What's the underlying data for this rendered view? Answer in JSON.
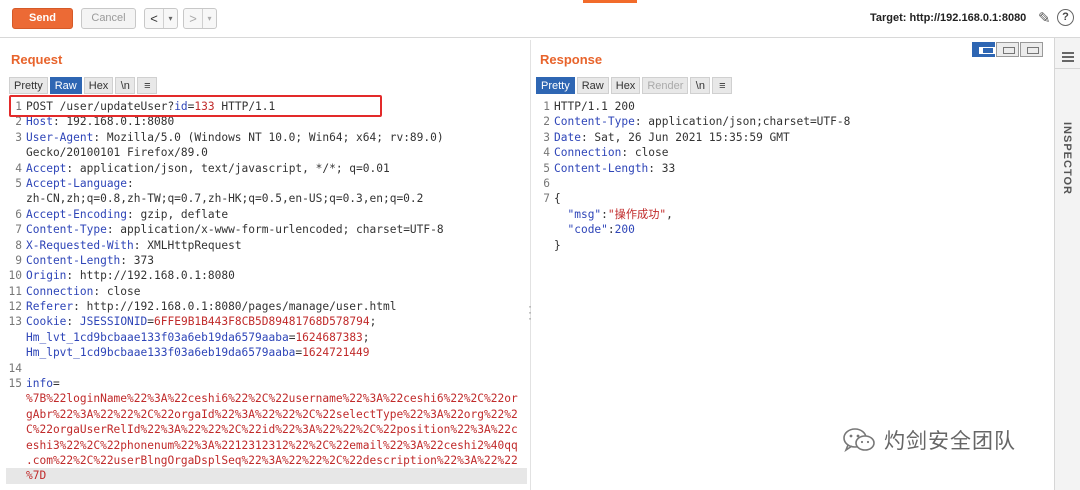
{
  "toolbar": {
    "send": "Send",
    "cancel": "Cancel",
    "back": "<",
    "forward": ">",
    "dropdown": "▾",
    "target": "Target: http://192.168.0.1:8080",
    "help": "?"
  },
  "request": {
    "title": "Request",
    "tabs": [
      "Pretty",
      "Raw",
      "Hex",
      "\\n",
      "≡"
    ],
    "active_tab": "Raw"
  },
  "response": {
    "title": "Response",
    "tabs": [
      "Pretty",
      "Raw",
      "Hex",
      "Render",
      "\\n",
      "≡"
    ],
    "active_tab": "Pretty"
  },
  "request_lines": [
    {
      "n": "1",
      "parts": [
        [
          "t",
          "POST /user/updateUser?"
        ],
        [
          "b",
          "id"
        ],
        [
          "t",
          "="
        ],
        [
          "r",
          "133"
        ],
        [
          "t",
          " HTTP/1.1"
        ]
      ]
    },
    {
      "n": "2",
      "parts": [
        [
          "h",
          "Host"
        ],
        [
          "t",
          ": 192.168.0.1:8080"
        ]
      ]
    },
    {
      "n": "3",
      "parts": [
        [
          "h",
          "User-Agent"
        ],
        [
          "t",
          ": Mozilla/5.0 (Windows NT 10.0; Win64; x64; rv:89.0)"
        ]
      ]
    },
    {
      "n": "",
      "parts": [
        [
          "t",
          "Gecko/20100101 Firefox/89.0"
        ]
      ]
    },
    {
      "n": "4",
      "parts": [
        [
          "h",
          "Accept"
        ],
        [
          "t",
          ": application/json, text/javascript, */*; q=0.01"
        ]
      ]
    },
    {
      "n": "5",
      "parts": [
        [
          "h",
          "Accept-Language"
        ],
        [
          "t",
          ":"
        ]
      ]
    },
    {
      "n": "",
      "parts": [
        [
          "t",
          "zh-CN,zh;q=0.8,zh-TW;q=0.7,zh-HK;q=0.5,en-US;q=0.3,en;q=0.2"
        ]
      ]
    },
    {
      "n": "6",
      "parts": [
        [
          "h",
          "Accept-Encoding"
        ],
        [
          "t",
          ": gzip, deflate"
        ]
      ]
    },
    {
      "n": "7",
      "parts": [
        [
          "h",
          "Content-Type"
        ],
        [
          "t",
          ": application/x-www-form-urlencoded; charset=UTF-8"
        ]
      ]
    },
    {
      "n": "8",
      "parts": [
        [
          "h",
          "X-Requested-With"
        ],
        [
          "t",
          ": XMLHttpRequest"
        ]
      ]
    },
    {
      "n": "9",
      "parts": [
        [
          "h",
          "Content-Length"
        ],
        [
          "t",
          ": 373"
        ]
      ]
    },
    {
      "n": "10",
      "parts": [
        [
          "h",
          "Origin"
        ],
        [
          "t",
          ": http://192.168.0.1:8080"
        ]
      ]
    },
    {
      "n": "11",
      "parts": [
        [
          "h",
          "Connection"
        ],
        [
          "t",
          ": close"
        ]
      ]
    },
    {
      "n": "12",
      "parts": [
        [
          "h",
          "Referer"
        ],
        [
          "t",
          ": http://192.168.0.1:8080/pages/manage/user.html"
        ]
      ]
    },
    {
      "n": "13",
      "parts": [
        [
          "h",
          "Cookie"
        ],
        [
          "t",
          ": "
        ],
        [
          "b",
          "JSESSIONID"
        ],
        [
          "t",
          "="
        ],
        [
          "r",
          "6FFE9B1B443F8CB5D89481768D578794"
        ],
        [
          "t",
          ";"
        ]
      ]
    },
    {
      "n": "",
      "parts": [
        [
          "b",
          "Hm_lvt_1cd9bcbaae133f03a6eb19da6579aaba"
        ],
        [
          "t",
          "="
        ],
        [
          "r",
          "1624687383"
        ],
        [
          "t",
          ";"
        ]
      ]
    },
    {
      "n": "",
      "parts": [
        [
          "b",
          "Hm_lpvt_1cd9bcbaae133f03a6eb19da6579aaba"
        ],
        [
          "t",
          "="
        ],
        [
          "r",
          "1624721449"
        ]
      ]
    },
    {
      "n": "14",
      "parts": []
    },
    {
      "n": "15",
      "parts": [
        [
          "b",
          "info"
        ],
        [
          "t",
          "="
        ]
      ]
    },
    {
      "n": "",
      "parts": [
        [
          "r",
          "%7B%22loginName%22%3A%22ceshi6%22%2C%22username%22%3A%22ceshi6%22%2C%22or"
        ]
      ]
    },
    {
      "n": "",
      "parts": [
        [
          "r",
          "gAbr%22%3A%22%22%2C%22orgaId%22%3A%22%22%2C%22selectType%22%3A%22org%22%2"
        ]
      ]
    },
    {
      "n": "",
      "parts": [
        [
          "r",
          "C%22orgaUserRelId%22%3A%22%22%2C%22id%22%3A%22%22%2C%22position%22%3A%22c"
        ]
      ]
    },
    {
      "n": "",
      "parts": [
        [
          "r",
          "eshi3%22%2C%22phonenum%22%3A%2212312312%22%2C%22email%22%3A%22ceshi2%40qq"
        ]
      ]
    },
    {
      "n": "",
      "parts": [
        [
          "r",
          ".com%22%2C%22userBlngOrgaDsplSeq%22%3A%22%22%2C%22description%22%3A%22%22"
        ]
      ]
    },
    {
      "n": "",
      "parts": [
        [
          "r",
          "%7D"
        ]
      ],
      "hl": true
    }
  ],
  "response_lines": [
    {
      "n": "1",
      "parts": [
        [
          "t",
          "HTTP/1.1 200"
        ]
      ]
    },
    {
      "n": "2",
      "parts": [
        [
          "h",
          "Content-Type"
        ],
        [
          "t",
          ": application/json;charset=UTF-8"
        ]
      ]
    },
    {
      "n": "3",
      "parts": [
        [
          "h",
          "Date"
        ],
        [
          "t",
          ": Sat, 26 Jun 2021 15:35:59 GMT"
        ]
      ]
    },
    {
      "n": "4",
      "parts": [
        [
          "h",
          "Connection"
        ],
        [
          "t",
          ": close"
        ]
      ]
    },
    {
      "n": "5",
      "parts": [
        [
          "h",
          "Content-Length"
        ],
        [
          "t",
          ": 33"
        ]
      ]
    },
    {
      "n": "6",
      "parts": []
    },
    {
      "n": "7",
      "parts": [
        [
          "t",
          "{"
        ]
      ]
    },
    {
      "n": "",
      "parts": [
        [
          "t",
          "  "
        ],
        [
          "b",
          "\"msg\""
        ],
        [
          "t",
          ":"
        ],
        [
          "r",
          "\"操作成功\""
        ],
        [
          "t",
          ","
        ]
      ]
    },
    {
      "n": "",
      "parts": [
        [
          "t",
          "  "
        ],
        [
          "b",
          "\"code\""
        ],
        [
          "t",
          ":"
        ],
        [
          "b",
          "200"
        ]
      ]
    },
    {
      "n": "",
      "parts": [
        [
          "t",
          "}"
        ]
      ]
    }
  ],
  "inspector": {
    "label": "INSPECTOR"
  },
  "watermark": {
    "text": "灼剑安全团队"
  },
  "colors": {
    "accent": "#e8642c",
    "send": "#ec6a35",
    "tab_active": "#2e66b3",
    "header_name": "#2e45b8",
    "value": "#c02a2a",
    "highlight_box": "#e32a2a"
  }
}
